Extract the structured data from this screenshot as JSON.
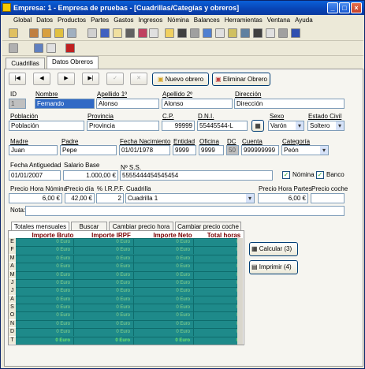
{
  "window": {
    "title": "Empresa: 1 - Empresa de pruebas - [Cuadrillas/Categías y obreros]",
    "min": "_",
    "max": "□",
    "close": "×"
  },
  "menu": [
    "Global",
    "Datos",
    "Productos",
    "Partes",
    "Gastos",
    "Ingresos",
    "Nómina",
    "Balances",
    "Herramientas",
    "Ventana",
    "Ayuda"
  ],
  "tabs": [
    "Cuadrillas",
    "Datos Obreros"
  ],
  "nav": {
    "first": "|◀",
    "prev": "◀",
    "next": "▶",
    "last": "▶|",
    "new_label": "Nuevo obrero",
    "delete_label": "Eliminar Obrero"
  },
  "labels": {
    "id": "ID",
    "nombre": "Nombre",
    "ap1": "Apellido 1º",
    "ap2": "Apellido 2º",
    "direccion": "Dirección",
    "poblacion": "Población",
    "provincia": "Provincia",
    "cp": "C.P.",
    "dni": "D.N.I.",
    "sexo": "Sexo",
    "estado": "Estado Civil",
    "madre": "Madre",
    "padre": "Padre",
    "fnac": "Fecha Nacimiento",
    "entidad": "Entidad",
    "oficina": "Oficina",
    "dc": "DC",
    "cuenta": "Cuenta",
    "categoria": "Categoría",
    "fant": "Fecha Antiguedad",
    "salario": "Salario Base",
    "nss": "Nº S.S.",
    "nomina": "Nómina",
    "banco": "Banco",
    "phn": "Precio Hora Nómina",
    "pdia": "Precio día",
    "irpf": "% I.R.P.F.",
    "cuadrilla": "Cuadrilla",
    "php": "Precio Hora Partes",
    "pcoche": "Precio coche",
    "nota": "Nota:"
  },
  "values": {
    "id": "1",
    "nombre": "Fernando",
    "ap1": "Alonso",
    "ap2": "Alonso",
    "direccion": "Dirección",
    "poblacion": "Población",
    "provincia": "Provincia",
    "cp": "99999",
    "dni": "55445544-L",
    "sexo": "Varón",
    "estado": "Soltero",
    "madre": "Juan",
    "padre": "Pepe",
    "fnac": "01/01/1978",
    "entidad": "9999",
    "oficina": "9999",
    "dc": "50",
    "cuenta": "999999999",
    "categoria": "Peón",
    "fant": "01/01/2007",
    "salario": "1.000,00 €",
    "nss": "5555444454545454",
    "phn": "6,00 €",
    "pdia": "42,00 €",
    "irpf": "2",
    "cuadrilla": "Cuadrilla 1",
    "php": "6,00 €"
  },
  "checks": {
    "nomina": true,
    "banco": true
  },
  "bottom_tabs": [
    "Totales mensuales",
    "Buscar",
    "Cambiar precio hora",
    "Cambiar precio coche"
  ],
  "grid": {
    "headers": [
      "Importe Bruto",
      "Importe IRPF",
      "Importe Neto",
      "Total horas"
    ],
    "months": [
      "E",
      "F",
      "M",
      "A",
      "M",
      "J",
      "J",
      "A",
      "S",
      "O",
      "N",
      "D",
      "T"
    ],
    "cells": [
      [
        "0 Euro",
        "0 Euro",
        "0 Euro",
        "0"
      ],
      [
        "0 Euro",
        "0 Euro",
        "0 Euro",
        "0"
      ],
      [
        "0 Euro",
        "0 Euro",
        "0 Euro",
        "0"
      ],
      [
        "0 Euro",
        "0 Euro",
        "0 Euro",
        "0"
      ],
      [
        "0 Euro",
        "0 Euro",
        "0 Euro",
        "0"
      ],
      [
        "0 Euro",
        "0 Euro",
        "0 Euro",
        "0"
      ],
      [
        "0 Euro",
        "0 Euro",
        "0 Euro",
        "0"
      ],
      [
        "0 Euro",
        "0 Euro",
        "0 Euro",
        "0"
      ],
      [
        "0 Euro",
        "0 Euro",
        "0 Euro",
        "0"
      ],
      [
        "0 Euro",
        "0 Euro",
        "0 Euro",
        "0"
      ],
      [
        "0 Euro",
        "0 Euro",
        "0 Euro",
        "0"
      ],
      [
        "0 Euro",
        "0 Euro",
        "0 Euro",
        "0"
      ],
      [
        "0 Euro",
        "0 Euro",
        "0 Euro",
        "0"
      ]
    ]
  },
  "side_buttons": {
    "calc": "Calcular (3)",
    "print": "Imprimir (4)"
  },
  "colors": {
    "title_bar": "#0843b4",
    "grid_bg": "#1e8a8a",
    "grid_text": "#8ad48a",
    "header_text": "#7a0000"
  }
}
